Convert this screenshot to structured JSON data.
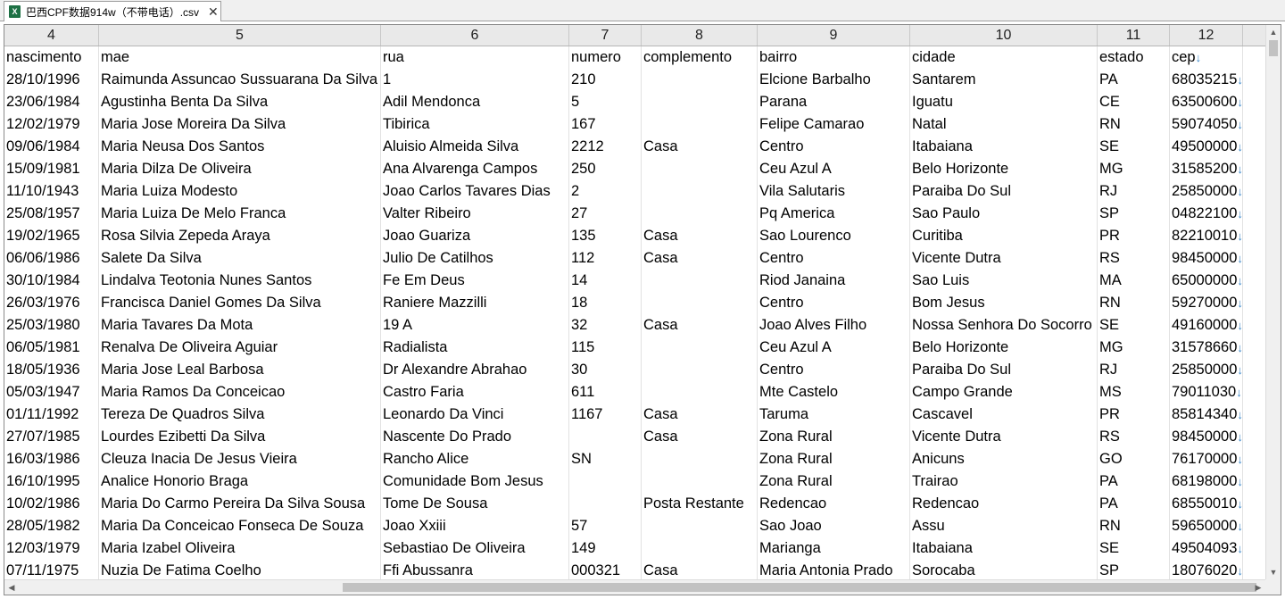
{
  "tab": {
    "icon": "excel-file-icon",
    "title": "巴西CPF数据914w（不带电话）.csv",
    "close": "✕"
  },
  "column_numbers": [
    "4",
    "5",
    "6",
    "7",
    "8",
    "9",
    "10",
    "11",
    "12"
  ],
  "header_row": [
    "nascimento",
    "mae",
    "rua",
    "numero",
    "complemento",
    "bairro",
    "cidade",
    "estado",
    "cep"
  ],
  "wrap_mark": "↓",
  "rows": [
    [
      "28/10/1996",
      "Raimunda Assuncao Sussuarana Da Silva",
      "1",
      "210",
      "",
      "Elcione Barbalho",
      "Santarem",
      "PA",
      "68035215"
    ],
    [
      "23/06/1984",
      "Agustinha Benta Da Silva",
      "Adil Mendonca",
      "5",
      "",
      "Parana",
      "Iguatu",
      "CE",
      "63500600"
    ],
    [
      "12/02/1979",
      "Maria Jose Moreira Da Silva",
      "Tibirica",
      "167",
      "",
      "Felipe Camarao",
      "Natal",
      "RN",
      "59074050"
    ],
    [
      "09/06/1984",
      "Maria Neusa Dos Santos",
      "Aluisio Almeida Silva",
      "2212",
      "Casa",
      "Centro",
      "Itabaiana",
      "SE",
      "49500000"
    ],
    [
      "15/09/1981",
      "Maria Dilza De Oliveira",
      "Ana Alvarenga Campos",
      "250",
      "",
      "Ceu Azul A",
      "Belo Horizonte",
      "MG",
      "31585200"
    ],
    [
      "11/10/1943",
      "Maria Luiza Modesto",
      "Joao Carlos Tavares Dias",
      "2",
      "",
      "Vila Salutaris",
      "Paraiba Do Sul",
      "RJ",
      "25850000"
    ],
    [
      "25/08/1957",
      "Maria Luiza De Melo Franca",
      "Valter Ribeiro",
      "27",
      "",
      "Pq America",
      "Sao Paulo",
      "SP",
      "04822100"
    ],
    [
      "19/02/1965",
      "Rosa Silvia Zepeda Araya",
      "Joao Guariza",
      "135",
      "Casa",
      "Sao Lourenco",
      "Curitiba",
      "PR",
      "82210010"
    ],
    [
      "06/06/1986",
      "Salete Da Silva",
      "Julio De Catilhos",
      "112",
      "Casa",
      "Centro",
      "Vicente Dutra",
      "RS",
      "98450000"
    ],
    [
      "30/10/1984",
      "Lindalva Teotonia Nunes Santos",
      "Fe Em Deus",
      "14",
      "",
      "Riod Janaina",
      "Sao Luis",
      "MA",
      "65000000"
    ],
    [
      "26/03/1976",
      "Francisca Daniel Gomes Da Silva",
      "Raniere Mazzilli",
      "18",
      "",
      "Centro",
      "Bom Jesus",
      "RN",
      "59270000"
    ],
    [
      "25/03/1980",
      "Maria Tavares Da Mota",
      "19 A",
      "32",
      "Casa",
      "Joao Alves Filho",
      "Nossa Senhora Do Socorro",
      "SE",
      "49160000"
    ],
    [
      "06/05/1981",
      "Renalva De Oliveira Aguiar",
      "Radialista",
      "115",
      "",
      "Ceu Azul A",
      "Belo Horizonte",
      "MG",
      "31578660"
    ],
    [
      "18/05/1936",
      "Maria Jose Leal Barbosa",
      "Dr Alexandre Abrahao",
      "30",
      "",
      "Centro",
      "Paraiba Do Sul",
      "RJ",
      "25850000"
    ],
    [
      "05/03/1947",
      "Maria Ramos Da Conceicao",
      "Castro Faria",
      "611",
      "",
      "Mte Castelo",
      "Campo Grande",
      "MS",
      "79011030"
    ],
    [
      "01/11/1992",
      "Tereza De Quadros Silva",
      "Leonardo Da Vinci",
      "1167",
      "Casa",
      "Taruma",
      "Cascavel",
      "PR",
      "85814340"
    ],
    [
      "27/07/1985",
      "Lourdes Ezibetti Da Silva",
      "Nascente Do Prado",
      "",
      "Casa",
      "Zona Rural",
      "Vicente Dutra",
      "RS",
      "98450000"
    ],
    [
      "16/03/1986",
      "Cleuza Inacia De Jesus Vieira",
      "Rancho Alice",
      "SN",
      "",
      "Zona Rural",
      "Anicuns",
      "GO",
      "76170000"
    ],
    [
      "16/10/1995",
      "Analice Honorio Braga",
      "Comunidade Bom Jesus",
      "",
      "",
      "Zona Rural",
      "Trairao",
      "PA",
      "68198000"
    ],
    [
      "10/02/1986",
      "Maria Do Carmo Pereira Da Silva Sousa",
      "Tome De Sousa",
      "",
      "Posta Restante",
      "Redencao",
      "Redencao",
      "PA",
      "68550010"
    ],
    [
      "28/05/1982",
      "Maria Da Conceicao Fonseca De Souza",
      "Joao Xxiii",
      "57",
      "",
      "Sao Joao",
      "Assu",
      "RN",
      "59650000"
    ],
    [
      "12/03/1979",
      "Maria Izabel Oliveira",
      "Sebastiao De Oliveira",
      "149",
      "",
      "Marianga",
      "Itabaiana",
      "SE",
      "49504093"
    ],
    [
      "07/11/1975",
      "Nuzia De Fatima Coelho",
      "Ffi Abussanra",
      "000321",
      "Casa",
      "Maria Antonia Prado",
      "Sorocaba",
      "SP",
      "18076020"
    ]
  ],
  "scroll": {
    "up": "▲",
    "down": "▼",
    "left": "◀",
    "right": "▶"
  }
}
